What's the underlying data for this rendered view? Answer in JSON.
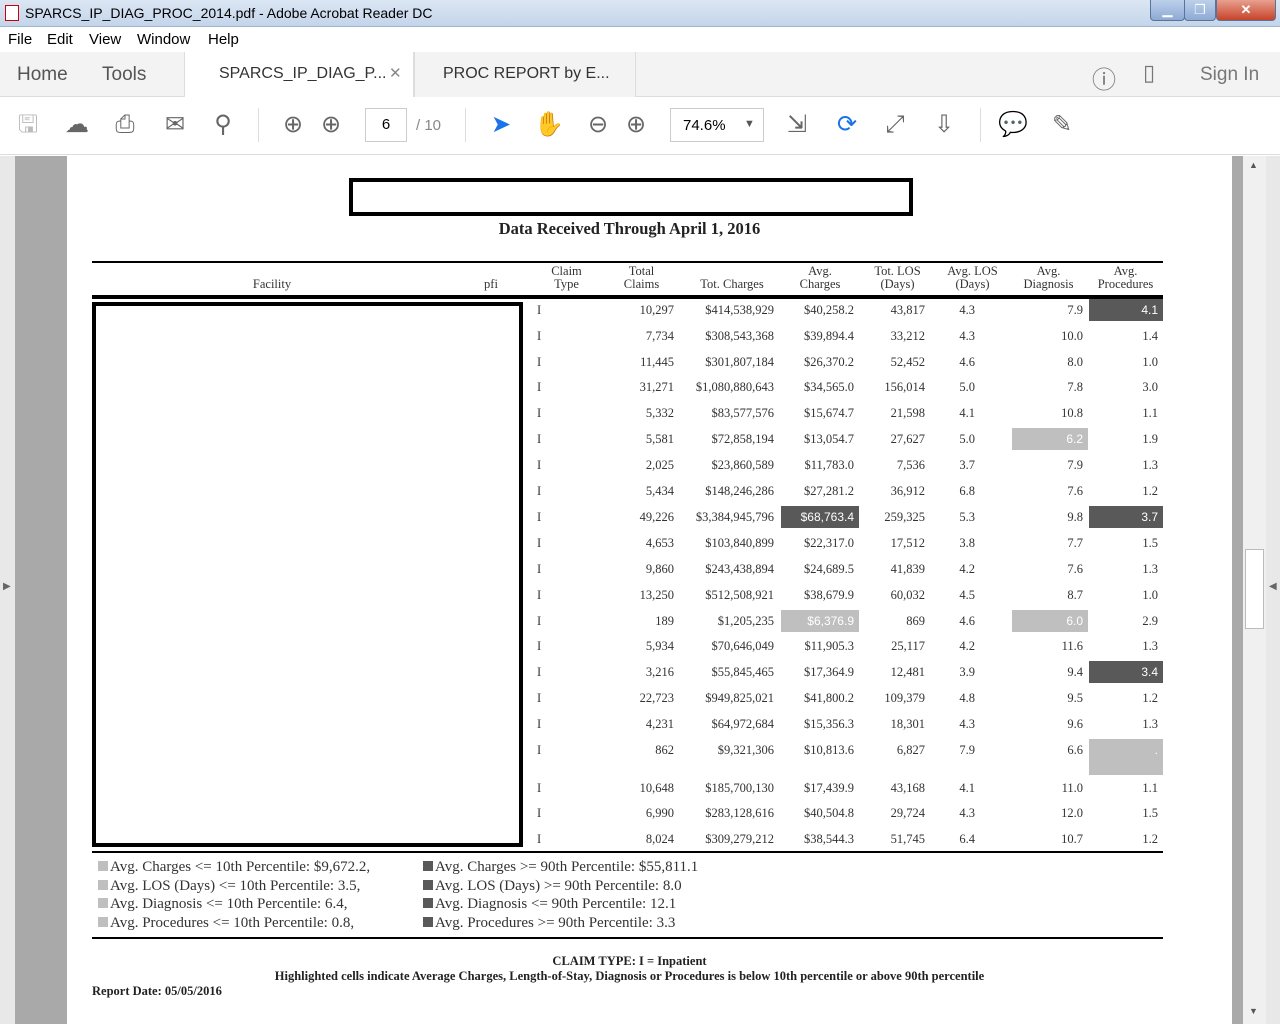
{
  "window": {
    "title": "SPARCS_IP_DIAG_PROC_2014.pdf - Adobe Acrobat Reader DC"
  },
  "menu": [
    "File",
    "Edit",
    "View",
    "Window",
    "Help"
  ],
  "nav": {
    "home": "Home",
    "tools": "Tools",
    "sign_in": "Sign In"
  },
  "tabs": [
    {
      "label": "SPARCS_IP_DIAG_P...",
      "active": true
    },
    {
      "label": "PROC REPORT by E...",
      "active": false
    }
  ],
  "toolbar": {
    "page_current": "6",
    "page_total": "/ 10",
    "zoom": "74.6%"
  },
  "report": {
    "title_line": "Data Received Through April 1, 2016",
    "headers": {
      "facility": "Facility",
      "pfi": "pfi",
      "claim_type": [
        "Claim",
        "Type"
      ],
      "total_claims": [
        "Total",
        "Claims"
      ],
      "tot_charges": "Tot. Charges",
      "avg_charges": [
        "Avg.",
        "Charges"
      ],
      "tot_los": [
        "Tot. LOS",
        "(Days)"
      ],
      "avg_los": [
        "Avg. LOS",
        "(Days)"
      ],
      "avg_diagnosis": [
        "Avg.",
        "Diagnosis"
      ],
      "avg_procedures": [
        "Avg.",
        "Procedures"
      ]
    },
    "colors": {
      "low": "#bfbfbf",
      "high": "#595959"
    },
    "rows": [
      [
        "I",
        "10,297",
        "$414,538,929",
        "$40,258.2",
        "43,817",
        "4.3",
        "7.9",
        "4.1",
        "",
        "",
        "",
        "",
        "h"
      ],
      [
        "I",
        "7,734",
        "$308,543,368",
        "$39,894.4",
        "33,212",
        "4.3",
        "10.0",
        "1.4"
      ],
      [
        "I",
        "11,445",
        "$301,807,184",
        "$26,370.2",
        "52,452",
        "4.6",
        "8.0",
        "1.0"
      ],
      [
        "I",
        "31,271",
        "$1,080,880,643",
        "$34,565.0",
        "156,014",
        "5.0",
        "7.8",
        "3.0"
      ],
      [
        "I",
        "5,332",
        "$83,577,576",
        "$15,674.7",
        "21,598",
        "4.1",
        "10.8",
        "1.1"
      ],
      [
        "I",
        "5,581",
        "$72,858,194",
        "$13,054.7",
        "27,627",
        "5.0",
        "6.2",
        "1.9",
        "",
        "",
        "",
        "l",
        ""
      ],
      [
        "I",
        "2,025",
        "$23,860,589",
        "$11,783.0",
        "7,536",
        "3.7",
        "7.9",
        "1.3"
      ],
      [
        "I",
        "5,434",
        "$148,246,286",
        "$27,281.2",
        "36,912",
        "6.8",
        "7.6",
        "1.2"
      ],
      [
        "I",
        "49,226",
        "$3,384,945,796",
        "$68,763.4",
        "259,325",
        "5.3",
        "9.8",
        "3.7",
        "",
        "h",
        "",
        "",
        "h"
      ],
      [
        "I",
        "4,653",
        "$103,840,899",
        "$22,317.0",
        "17,512",
        "3.8",
        "7.7",
        "1.5"
      ],
      [
        "I",
        "9,860",
        "$243,438,894",
        "$24,689.5",
        "41,839",
        "4.2",
        "7.6",
        "1.3"
      ],
      [
        "I",
        "13,250",
        "$512,508,921",
        "$38,679.9",
        "60,032",
        "4.5",
        "8.7",
        "1.0"
      ],
      [
        "I",
        "189",
        "$1,205,235",
        "$6,376.9",
        "869",
        "4.6",
        "6.0",
        "2.9",
        "",
        "l",
        "",
        "l",
        ""
      ],
      [
        "I",
        "5,934",
        "$70,646,049",
        "$11,905.3",
        "25,117",
        "4.2",
        "11.6",
        "1.3"
      ],
      [
        "I",
        "3,216",
        "$55,845,465",
        "$17,364.9",
        "12,481",
        "3.9",
        "9.4",
        "3.4",
        "",
        "",
        "",
        "",
        "h"
      ],
      [
        "I",
        "22,723",
        "$949,825,021",
        "$41,800.2",
        "109,379",
        "4.8",
        "9.5",
        "1.2"
      ],
      [
        "I",
        "4,231",
        "$64,972,684",
        "$15,356.3",
        "18,301",
        "4.3",
        "9.6",
        "1.3"
      ],
      [
        "I",
        "862",
        "$9,321,306",
        "$10,813.6",
        "6,827",
        "7.9",
        "6.6",
        ".",
        "",
        "",
        "",
        "",
        "l"
      ],
      [
        "I",
        "10,648",
        "$185,700,130",
        "$17,439.9",
        "43,168",
        "4.1",
        "11.0",
        "1.1"
      ],
      [
        "I",
        "6,990",
        "$283,128,616",
        "$40,504.8",
        "29,724",
        "4.3",
        "12.0",
        "1.5"
      ],
      [
        "I",
        "8,024",
        "$309,279,212",
        "$38,544.3",
        "51,745",
        "6.4",
        "10.7",
        "1.2"
      ]
    ],
    "legend_low": [
      "Avg. Charges <= 10th Percentile: $9,672.2,",
      "Avg. LOS (Days) <= 10th Percentile: 3.5,",
      "Avg. Diagnosis <= 10th Percentile: 6.4,",
      "Avg. Procedures <= 10th Percentile: 0.8,"
    ],
    "legend_high": [
      "Avg. Charges >= 90th Percentile: $55,811.1",
      "Avg. LOS (Days) >= 90th Percentile: 8.0",
      "Avg. Diagnosis <= 90th Percentile: 12.1",
      "Avg. Procedures >= 90th Percentile: 3.3"
    ],
    "claim_type_note": "CLAIM TYPE: I = Inpatient",
    "highlight_note": "Highlighted cells indicate Average Charges, Length-of-Stay, Diagnosis or Procedures is below 10th percentile or above 90th percentile",
    "report_date": "Report Date: 05/05/2016"
  }
}
